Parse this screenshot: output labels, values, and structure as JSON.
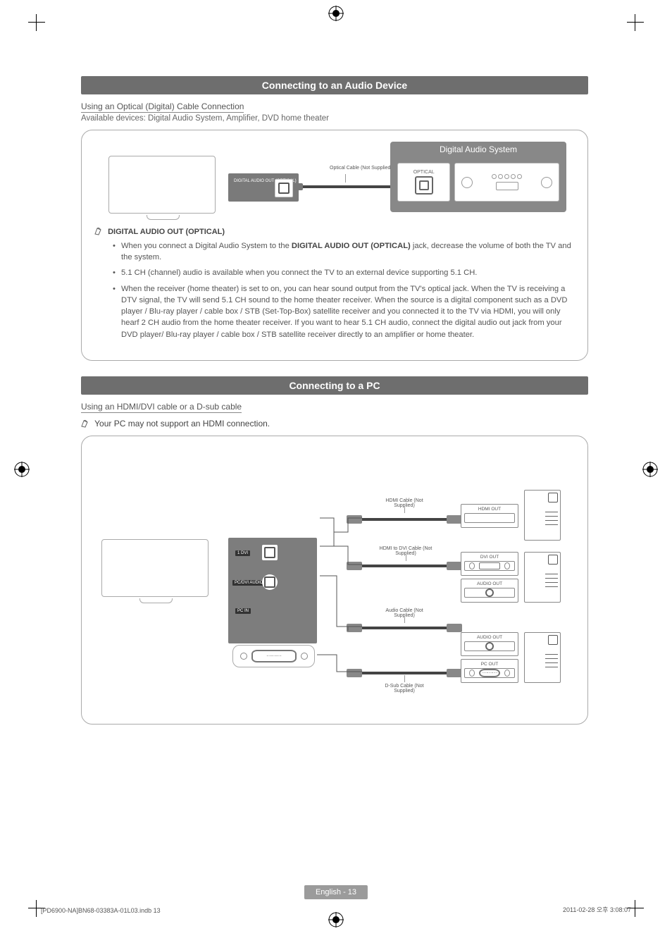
{
  "sections": {
    "audio": {
      "title": "Connecting to an Audio Device",
      "subtitle": "Using an Optical (Digital) Cable Connection",
      "available": "Available devices: Digital Audio System, Amplifier, DVD home theater",
      "diagram": {
        "port_label": "DIGITAL\nAUDIO OUT\n(OPTICAL)",
        "cable_label": "Optical Cable (Not Supplied)",
        "device_title": "Digital Audio System",
        "device_port_label": "OPTICAL"
      },
      "note_heading": "DIGITAL AUDIO OUT (OPTICAL)",
      "bullets": [
        {
          "pre": "When you connect a Digital Audio System to the ",
          "bold": "DIGITAL AUDIO OUT (OPTICAL)",
          "post": " jack, decrease the volume of both the TV and the system."
        },
        {
          "text": "5.1 CH (channel) audio is available when you connect the TV to an external device supporting 5.1 CH."
        },
        {
          "text": "When the receiver (home theater) is set to on, you can hear sound output from the TV's optical jack. When the TV is receiving a DTV signal, the TV will send 5.1 CH sound to the home theater receiver. When the source is a digital component such as a DVD player / Blu-ray player / cable box / STB (Set-Top-Box) satellite receiver and you connected it to the TV via HDMI, you will only hearf 2 CH audio from the home theater receiver. If you want to hear 5.1 CH audio, connect the digital audio out jack from your DVD player/ Blu-ray player / cable box / STB satellite receiver directly to an amplifier or home theater."
        }
      ]
    },
    "pc": {
      "title": "Connecting to a PC",
      "subtitle": "Using an HDMI/DVI cable or a D-sub cable",
      "note": "Your PC may not support an HDMI connection.",
      "diagram": {
        "tv_ports": {
          "dvi": "1 DVI",
          "audio": "PC/DVI\nAUDIO IN",
          "pcin": "PC IN"
        },
        "cables": {
          "hdmi": "HDMI Cable (Not Supplied)",
          "hdmi_dvi": "HDMI to DVI Cable (Not Supplied)",
          "audio": "Audio Cable (Not Supplied)",
          "dsub": "D-Sub Cable (Not Supplied)"
        },
        "pc_ports": {
          "hdmi_out": "HDMI OUT",
          "dvi_out": "DVI OUT",
          "audio_out": "AUDIO OUT",
          "pc_out": "PC OUT"
        }
      }
    }
  },
  "footer": {
    "page": "English - 13",
    "left": "[PD6900-NA]BN68-03383A-01L03.indb   13",
    "right": "2011-02-28   오후 3:08:07"
  }
}
